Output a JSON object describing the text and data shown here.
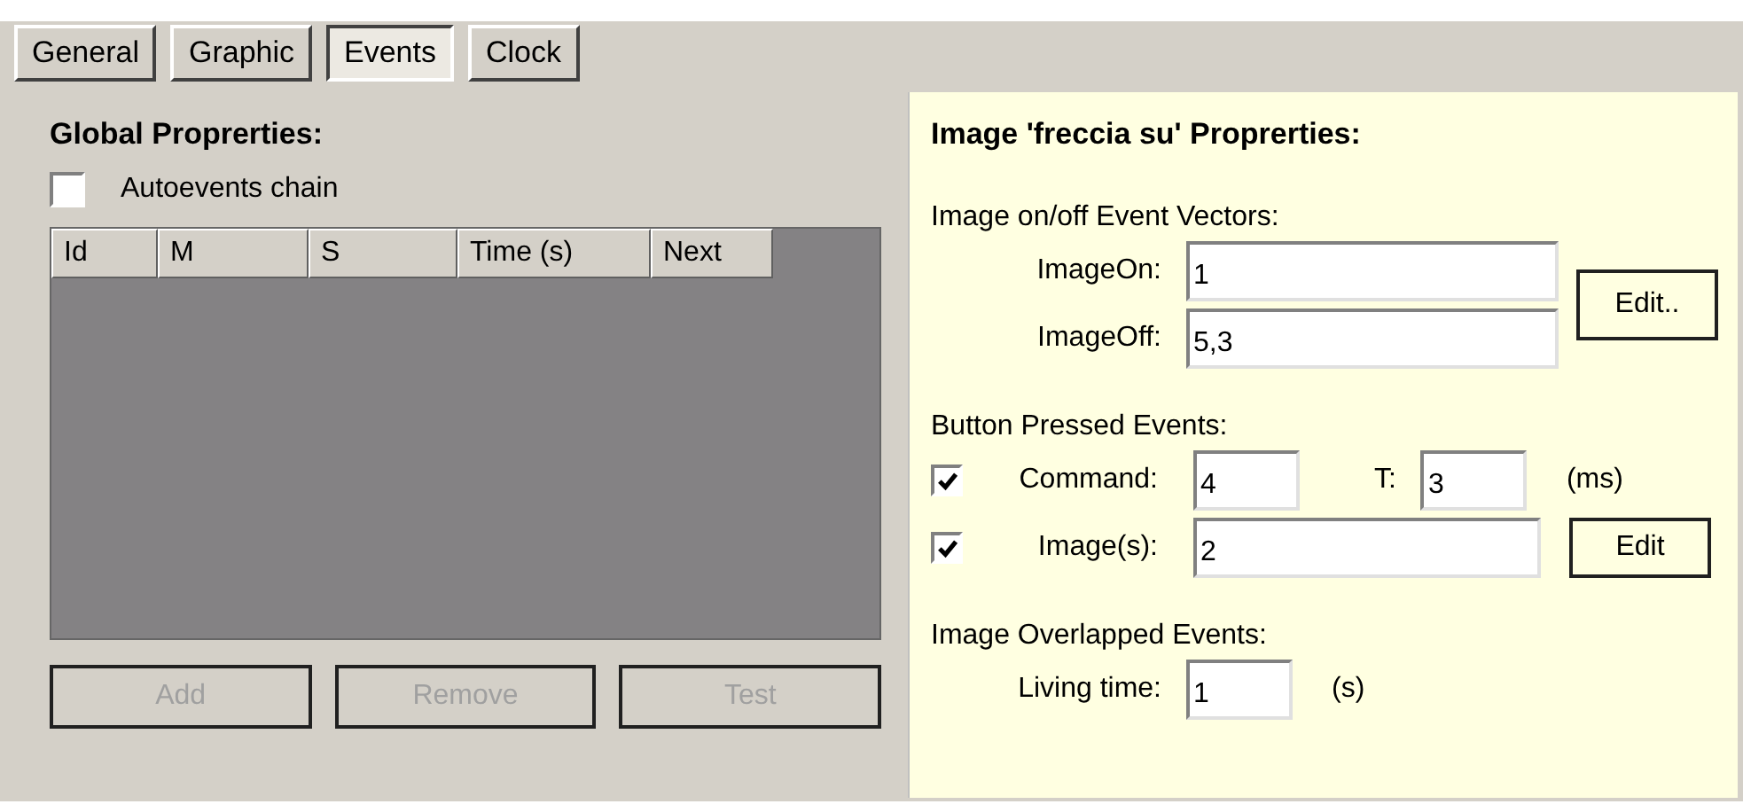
{
  "tabs": [
    {
      "label": "General",
      "selected": false
    },
    {
      "label": "Graphic",
      "selected": false
    },
    {
      "label": "Events",
      "selected": true
    },
    {
      "label": "Clock",
      "selected": false
    }
  ],
  "global": {
    "title": "Global Proprerties:",
    "autoevents": {
      "label": "Autoevents chain",
      "checked": false
    },
    "table": {
      "columns": [
        "Id",
        "M",
        "S",
        "Time (s)",
        "Next"
      ]
    },
    "buttons": [
      {
        "label": "Add",
        "disabled": true
      },
      {
        "label": "Remove",
        "disabled": true
      },
      {
        "label": "Test",
        "disabled": true
      }
    ]
  },
  "image": {
    "title": "Image 'freccia su' Proprerties:",
    "vectors": {
      "heading": "Image on/off Event Vectors:",
      "image_on": {
        "label": "ImageOn:",
        "value": "1"
      },
      "image_off": {
        "label": "ImageOff:",
        "value": "5,3"
      },
      "edit_button": "Edit.."
    },
    "pressed": {
      "heading": "Button Pressed Events:",
      "command": {
        "label": "Command:",
        "checked": true,
        "value": "4",
        "t_label": "T:",
        "t_value": "3",
        "unit": "(ms)"
      },
      "images": {
        "label": "Image(s):",
        "checked": true,
        "value": "2"
      },
      "edit_button": "Edit"
    },
    "overlapped": {
      "heading": "Image Overlapped Events:",
      "living_time": {
        "label": "Living time:",
        "value": "1",
        "unit": "(s)"
      }
    }
  }
}
